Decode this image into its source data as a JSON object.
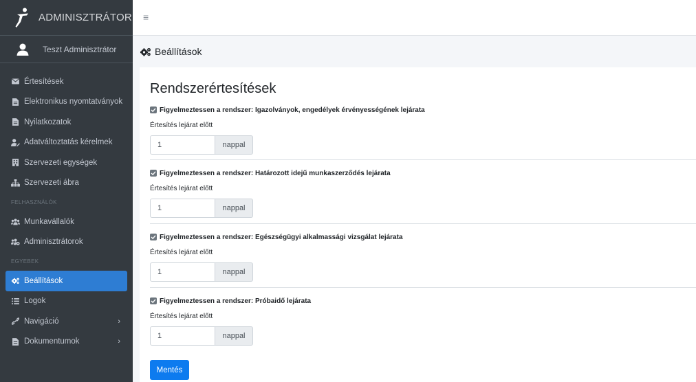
{
  "brand": {
    "title": "ADMINISZTRÁTOR"
  },
  "user": {
    "name": "Teszt Adminisztrátor"
  },
  "sidebar": {
    "items": [
      {
        "label": "Értesítések",
        "icon": "envelope-icon"
      },
      {
        "label": "Elektronikus nyomtatványok",
        "icon": "file-icon"
      },
      {
        "label": "Nyilatkozatok",
        "icon": "file-icon"
      },
      {
        "label": "Adatváltoztatás kérelmek",
        "icon": "user-edit-icon"
      },
      {
        "label": "Szervezeti egységek",
        "icon": "building-icon"
      },
      {
        "label": "Szervezeti ábra",
        "icon": "sitemap-icon"
      }
    ],
    "header_users": "FELHASZNÁLÓK",
    "users_items": [
      {
        "label": "Munkavállalók",
        "icon": "users-icon"
      },
      {
        "label": "Adminisztrátorok",
        "icon": "users-cog-icon"
      }
    ],
    "header_other": "EGYEBEK",
    "other_items": [
      {
        "label": "Beállítások",
        "icon": "cogs-icon",
        "active": true
      },
      {
        "label": "Logok",
        "icon": "list-icon"
      },
      {
        "label": "Navigáció",
        "icon": "link-icon",
        "chevron": "›"
      },
      {
        "label": "Dokumentumok",
        "icon": "file-icon",
        "chevron": "›"
      }
    ]
  },
  "topbar": {
    "menu_icon": "≡"
  },
  "page": {
    "title": "Beállítások"
  },
  "card": {
    "title": "Rendszerértesítések",
    "sections": [
      {
        "check_label": "Figyelmeztessen a rendszer: Igazolványok, engedélyek érvényességének lejárata",
        "field_label": "Értesítés lejárat előtt",
        "value": "1",
        "unit": "nappal",
        "checked": true
      },
      {
        "check_label": "Figyelmeztessen a rendszer: Határozott idejű munkaszerződés lejárata",
        "field_label": "Értesítés lejárat előtt",
        "value": "1",
        "unit": "nappal",
        "checked": true
      },
      {
        "check_label": "Figyelmeztessen a rendszer: Egészségügyi alkalmassági vizsgálat lejárata",
        "field_label": "Értesítés lejárat előtt",
        "value": "1",
        "unit": "nappal",
        "checked": true
      },
      {
        "check_label": "Figyelmeztessen a rendszer: Próbaidő lejárata",
        "field_label": "Értesítés lejárat előtt",
        "value": "1",
        "unit": "nappal",
        "checked": true
      }
    ],
    "save_label": "Mentés"
  },
  "colors": {
    "sidebar_bg": "#343a40",
    "active": "#2e7dd3",
    "primary_button": "#0d7bef",
    "content_bg": "#f4f6f9"
  }
}
